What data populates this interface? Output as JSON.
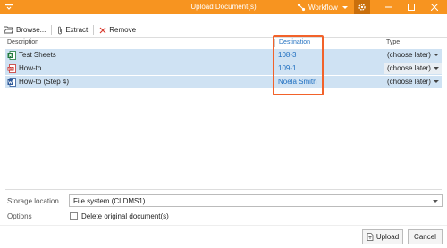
{
  "window": {
    "title": "Upload Document(s)",
    "workflow_label": "Workflow",
    "accent": "#f79420"
  },
  "toolbar": {
    "browse_label": "Browse...",
    "extract_label": "Extract",
    "remove_label": "Remove"
  },
  "grid": {
    "columns": {
      "description": "Description",
      "destination": "Destination",
      "type": "Type"
    },
    "rows": [
      {
        "name": "Test Sheets",
        "icon": "excel-icon",
        "destination": "108-3",
        "type": "(choose later)"
      },
      {
        "name": "How-to",
        "icon": "pdf-icon",
        "destination": "109-1",
        "type": "(choose later)"
      },
      {
        "name": "How-to (Step 4)",
        "icon": "word-icon",
        "destination": "Noela Smith",
        "type": "(choose later)"
      }
    ]
  },
  "form": {
    "storage_label": "Storage location",
    "storage_value": "File system (CLDMS1)",
    "options_label": "Options",
    "delete_label": "Delete original document(s)"
  },
  "buttons": {
    "upload_label": "Upload",
    "cancel_label": "Cancel"
  },
  "colors": {
    "highlight": "#f2622a",
    "link": "#1f6fc0",
    "row_selected": "#cfe2f3"
  }
}
